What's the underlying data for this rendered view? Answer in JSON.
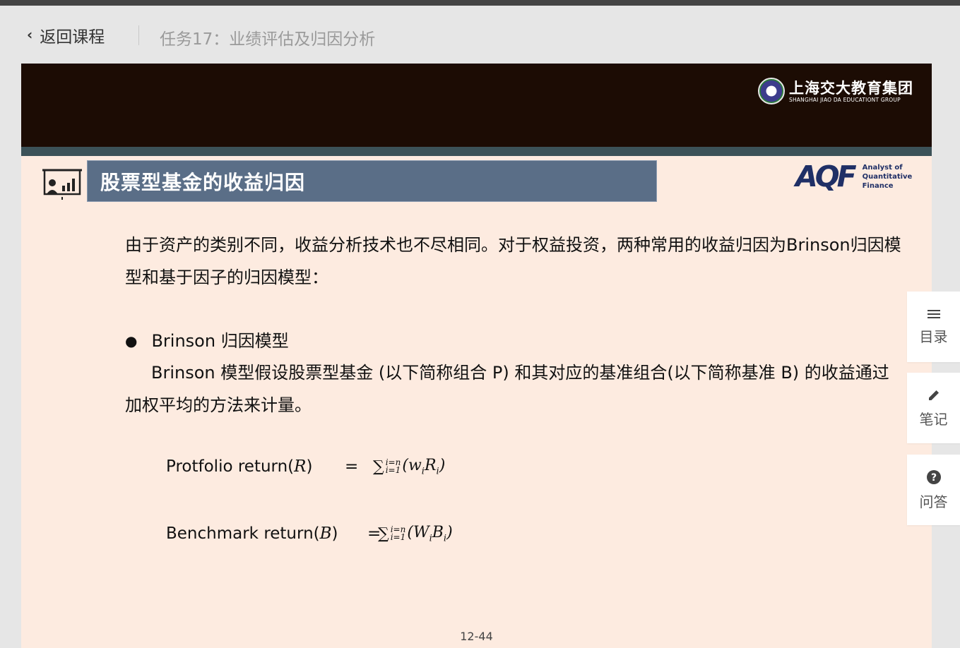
{
  "header": {
    "back_label": "返回课程",
    "task_title": "任务17：业绩评估及归因分析"
  },
  "slide": {
    "logo_cn": "上海交大教育集团",
    "logo_en": "SHANGHAI JIAO DA EDUCATIONT GROUP",
    "title": "股票型基金的收益归因",
    "aqf_mark": "AQF",
    "aqf_line1": "Analyst of",
    "aqf_line2": "Quantitative Finance",
    "para1": "由于资产的类别不同，收益分析技术也不尽相同。对于权益投资，两种常用的收益归因为Brinson归因模型和基于因子的归因模型：",
    "bullet": "Brinson 归因模型",
    "para2": "Brinson 模型假设股票型基金 (以下简称组合 P) 和其对应的基准组合(以下简称基准 B) 的收益通过加权平均的方法来计量。",
    "formula1_label": "Protfolio return(",
    "formula1_var": "R",
    "formula2_label": "Benchmark return(",
    "formula2_var": "B",
    "close_paren": ")",
    "equals": "=",
    "sigma": "∑",
    "sum_upper": "i=n",
    "sum_lower": "i=1",
    "f1_w": "w",
    "f1_r": "R",
    "f2_w": "W",
    "f2_r": "B",
    "subscript": "i",
    "page_number": "12-44"
  },
  "side": {
    "toc_label": "目录",
    "notes_label": "笔记",
    "qa_label": "问答"
  },
  "colors": {
    "slide_bg": "#fdebe0",
    "slide_top_bar": "#1c0c04",
    "accent_bar": "#3c5258",
    "title_band": "#5a6e87",
    "aqf_blue": "#1f2f66"
  }
}
